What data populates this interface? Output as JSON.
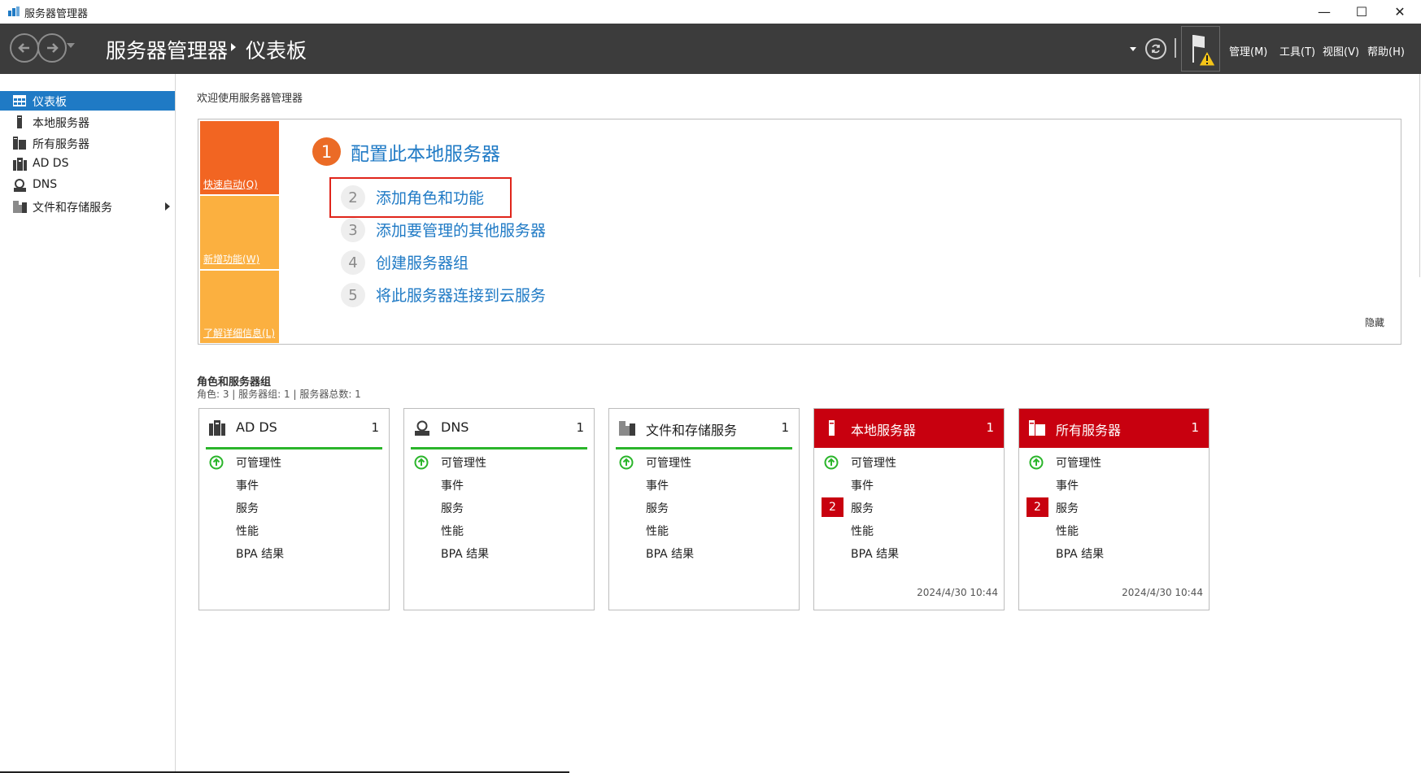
{
  "window": {
    "title": "服务器管理器",
    "minimize": "—",
    "maximize": "☐",
    "close": "✕"
  },
  "header": {
    "breadcrumb_root": "服务器管理器",
    "breadcrumb_page": "仪表板",
    "menus": [
      "管理(M)",
      "工具(T)",
      "视图(V)",
      "帮助(H)"
    ]
  },
  "sidebar": {
    "items": [
      {
        "label": "仪表板",
        "icon": "dashboard-icon",
        "active": true
      },
      {
        "label": "本地服务器",
        "icon": "server-icon"
      },
      {
        "label": "所有服务器",
        "icon": "servers-icon"
      },
      {
        "label": "AD DS",
        "icon": "ad-ds-icon"
      },
      {
        "label": "DNS",
        "icon": "dns-icon"
      },
      {
        "label": "文件和存储服务",
        "icon": "file-storage-icon",
        "has_submenu": true
      }
    ]
  },
  "welcome": {
    "title": "欢迎使用服务器管理器",
    "tabs": [
      "快速启动(Q)",
      "新增功能(W)",
      "了解详细信息(L)"
    ],
    "step1": {
      "num": "1",
      "label": "配置此本地服务器"
    },
    "steps": [
      {
        "num": "2",
        "label": "添加角色和功能"
      },
      {
        "num": "3",
        "label": "添加要管理的其他服务器"
      },
      {
        "num": "4",
        "label": "创建服务器组"
      },
      {
        "num": "5",
        "label": "将此服务器连接到云服务"
      }
    ],
    "hide": "隐藏"
  },
  "roles": {
    "title": "角色和服务器组",
    "summary": "角色: 3 | 服务器组: 1 | 服务器总数: 1",
    "tiles": [
      {
        "name": "AD DS",
        "count": "1",
        "rows": [
          "可管理性",
          "事件",
          "服务",
          "性能",
          "BPA 结果"
        ],
        "alert": false
      },
      {
        "name": "DNS",
        "count": "1",
        "rows": [
          "可管理性",
          "事件",
          "服务",
          "性能",
          "BPA 结果"
        ],
        "alert": false
      },
      {
        "name": "文件和存储服务",
        "count": "1",
        "rows": [
          "可管理性",
          "事件",
          "服务",
          "性能",
          "BPA 结果"
        ],
        "alert": false
      },
      {
        "name": "本地服务器",
        "count": "1",
        "rows": [
          "可管理性",
          "事件",
          "服务",
          "性能",
          "BPA 结果"
        ],
        "alert": true,
        "badge": "2",
        "timestamp": "2024/4/30 10:44"
      },
      {
        "name": "所有服务器",
        "count": "1",
        "rows": [
          "可管理性",
          "事件",
          "服务",
          "性能",
          "BPA 结果"
        ],
        "alert": true,
        "badge": "2",
        "timestamp": "2024/4/30 10:44"
      }
    ]
  },
  "colors": {
    "header_bg": "#3c3c3c",
    "accent_blue": "#1f7ac5",
    "quickstart_orange": "#f26522",
    "tab_yellow": "#fbb040",
    "alert_red": "#c8000f",
    "ok_green": "#2bb52b"
  }
}
